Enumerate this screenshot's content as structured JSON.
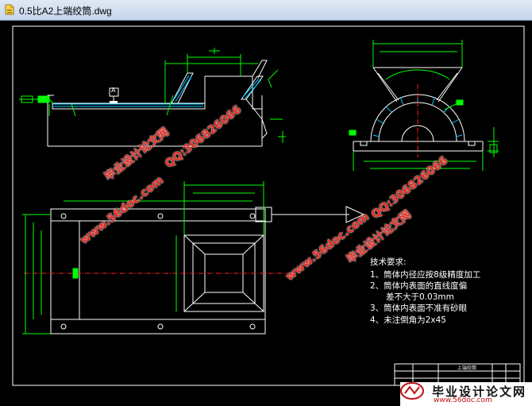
{
  "window": {
    "title": "0.5比A2上端绞筒.dwg"
  },
  "drawing": {
    "tech_title": "技术要求:",
    "tech_items": [
      "1、筒体内径应按8级精度加工",
      "2、筒体内表面的直线度偏",
      "差不大于0.03mm",
      "3、筒体内表面不准有砂眼",
      "4、未注倒角为2x45"
    ],
    "title_block_name": "上端绞筒",
    "datum_label": "A"
  },
  "watermarks": {
    "site_url": "www.56doc.com",
    "qq": "QQ:306826066",
    "brand": "毕业设计论文网"
  },
  "logo": {
    "brand": "毕业设计论文网",
    "url": "www.56doc.com"
  },
  "colors": {
    "background": "#000000",
    "geometry": "#ffffff",
    "dimensions": "#00ff00",
    "centerline": "#ff2020",
    "hatch": "#00c8ff",
    "watermark": "#e8281e"
  }
}
